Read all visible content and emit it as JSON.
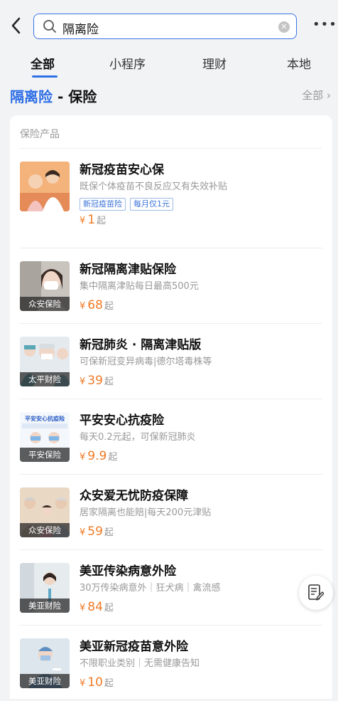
{
  "search": {
    "query": "隔离险"
  },
  "tabs": [
    {
      "label": "全部"
    },
    {
      "label": "小程序"
    },
    {
      "label": "理财"
    },
    {
      "label": "本地"
    }
  ],
  "section": {
    "keyword": "隔离险",
    "suffix": " - 保险",
    "all_label": "全部"
  },
  "card": {
    "heading": "保险产品"
  },
  "products": [
    {
      "title": "新冠疫苗安心保",
      "desc": "既保个体疫苗不良反应又有失效补贴",
      "tags": [
        "新冠疫苗险",
        "每月仅1元"
      ],
      "price": "1",
      "brand": ""
    },
    {
      "title": "新冠隔离津贴保险",
      "desc": "集中隔离津贴每日最高500元",
      "tags": [],
      "price": "68",
      "brand": "众安保险"
    },
    {
      "title": "新冠肺炎 · 隔离津贴版",
      "desc": "可保新冠变异病毒|德尔塔毒株等",
      "tags": [],
      "price": "39",
      "brand": "太平财险"
    },
    {
      "title": "平安安心抗疫险",
      "desc": "每天0.2元起，可保新冠肺炎",
      "tags": [],
      "price": "9.9",
      "brand": "平安保险",
      "thumb_text": "平安安心抗疫险"
    },
    {
      "title": "众安爱无忧防疫保障",
      "desc": "居家隔离也能赔|每天200元津贴",
      "tags": [],
      "price": "59",
      "brand": "众安保险"
    },
    {
      "title": "美亚传染病意外险",
      "desc": "30万传染病意外｜狂犬病｜禽流感",
      "tags": [],
      "price": "84",
      "brand": "美亚财险"
    },
    {
      "title": "美亚新冠疫苗意外险",
      "desc": "不限职业类别｜无需健康告知",
      "tags": [],
      "price": "10",
      "brand": "美亚财险"
    }
  ],
  "labels": {
    "currency": "¥",
    "from": "起"
  },
  "colors": {
    "accent": "#2f6fe6",
    "price": "#f07a26"
  }
}
